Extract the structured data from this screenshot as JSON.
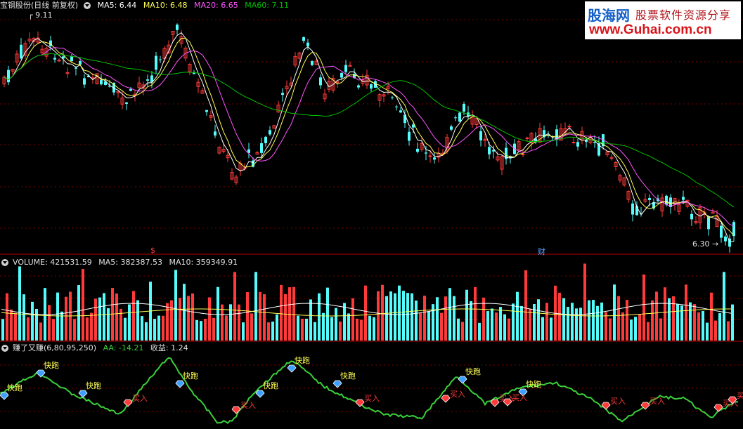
{
  "price_panel": {
    "title": "宝钢股份(日线 前复权)",
    "ma5": "MA5: 6.44",
    "ma10": "MA10: 6.48",
    "ma20": "MA20: 6.65",
    "ma60": "MA60: 7.11",
    "high_label": "9.11",
    "low_label": "6.30",
    "marker_left": "$",
    "marker_right": "财"
  },
  "volume_panel": {
    "volume": "VOLUME: 421531.59",
    "ma5": "MA5: 382387.53",
    "ma10": "MA10: 359349.91"
  },
  "indicator_panel": {
    "name": "赚了又赚(6,80,95,250)",
    "aa": "AA: -14.21",
    "profit": "收益: 1.24",
    "sell_label": "快跑",
    "buy_label": "买入"
  },
  "watermark": {
    "site_cn": "股海网",
    "slogan": "股票软件资源分享",
    "url": "www.Guhai.com.cn"
  },
  "colors": {
    "up": "#ff3a3a",
    "down": "#54fcfc",
    "ma5": "#ffffff",
    "ma10": "#ffff54",
    "ma20": "#ff54ff",
    "ma60": "#00c000",
    "indicator": "#3ad03a",
    "label_sell": "#ffff54",
    "label_buy": "#ff3a3a"
  }
}
